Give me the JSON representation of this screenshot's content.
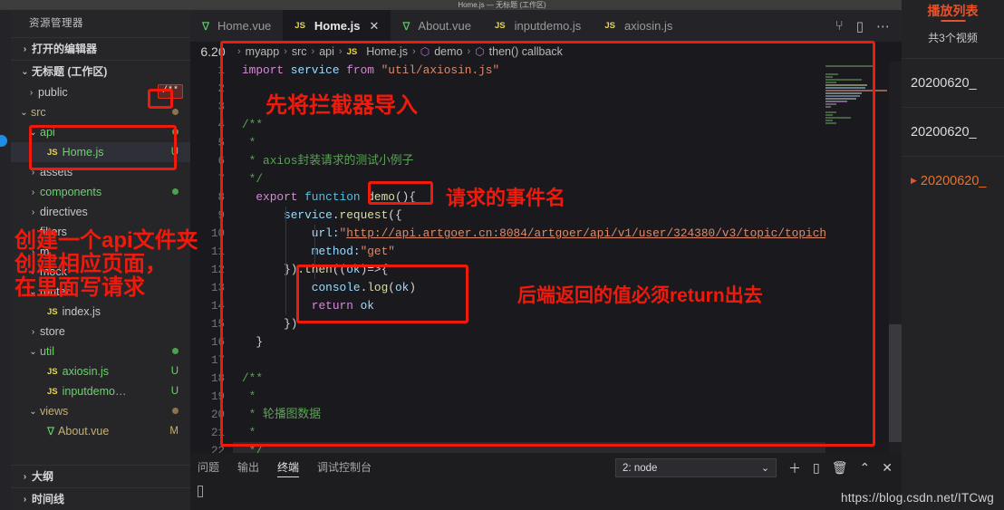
{
  "window": {
    "title": "Home.js — 无标题 (工作区)"
  },
  "sidebar": {
    "header": "资源管理器",
    "sections": [
      {
        "label": "打开的编辑器",
        "twisty": "›"
      },
      {
        "label": "无标题 (工作区)",
        "twisty": "⌄"
      }
    ],
    "tree": [
      {
        "twisty": "›",
        "label": "public",
        "indent": 30,
        "kind": "folder",
        "color": "#c8c8c8",
        "badge": "/**",
        "badge_kind": "comment-badge"
      },
      {
        "twisty": "⌄",
        "label": "src",
        "indent": 22,
        "kind": "folder",
        "color": "#c8b06a",
        "badge": "dot",
        "badge_color": "#8a7450"
      },
      {
        "twisty": "⌄",
        "label": "api",
        "indent": 32,
        "kind": "folder",
        "color": "#6ad46a",
        "badge": "dot",
        "badge_color": "#4f9f53"
      },
      {
        "twisty": "",
        "label": "Home.js",
        "indent": 40,
        "kind": "js",
        "color": "#6ad46a",
        "badge": "U",
        "badge_color": "#6ad46a",
        "selected": true
      },
      {
        "twisty": "›",
        "label": "assets",
        "indent": 32,
        "kind": "folder",
        "color": "#c8c8c8",
        "badge": ""
      },
      {
        "twisty": "›",
        "label": "components",
        "indent": 32,
        "kind": "folder",
        "color": "#6ad46a",
        "badge": "dot",
        "badge_color": "#4f9f53"
      },
      {
        "twisty": "›",
        "label": "directives",
        "indent": 32,
        "kind": "folder",
        "color": "#c8c8c8",
        "badge": ""
      },
      {
        "twisty": "›",
        "label": "filters",
        "indent": 32,
        "kind": "folder",
        "color": "#c8c8c8",
        "badge": ""
      },
      {
        "twisty": "›",
        "label": "m",
        "indent": 32,
        "kind": "folder",
        "color": "#c8c8c8",
        "badge": ""
      },
      {
        "twisty": "›",
        "label": "mock",
        "indent": 32,
        "kind": "folder",
        "color": "#c8c8c8",
        "badge": ""
      },
      {
        "twisty": "⌄",
        "label": "router",
        "indent": 32,
        "kind": "folder",
        "color": "#c8c8c8",
        "badge": ""
      },
      {
        "twisty": "",
        "label": "index.js",
        "indent": 40,
        "kind": "js",
        "color": "#c8c8c8",
        "badge": ""
      },
      {
        "twisty": "›",
        "label": "store",
        "indent": 32,
        "kind": "folder",
        "color": "#c8c8c8",
        "badge": ""
      },
      {
        "twisty": "⌄",
        "label": "util",
        "indent": 32,
        "kind": "folder",
        "color": "#6ad46a",
        "badge": "dot",
        "badge_color": "#4f9f53"
      },
      {
        "twisty": "",
        "label": "axiosin.js",
        "indent": 40,
        "kind": "js",
        "color": "#6ad46a",
        "badge": "U",
        "badge_color": "#6ad46a"
      },
      {
        "twisty": "",
        "label": "inputdemo…",
        "indent": 40,
        "kind": "js",
        "color": "#6ad46a",
        "badge": "U",
        "badge_color": "#6ad46a"
      },
      {
        "twisty": "⌄",
        "label": "views",
        "indent": 32,
        "kind": "folder",
        "color": "#c8b06a",
        "badge": "dot",
        "badge_color": "#8a7450"
      },
      {
        "twisty": "",
        "label": "About.vue",
        "indent": 40,
        "kind": "vue",
        "color": "#c8b06a",
        "badge": "M",
        "badge_color": "#c8b06a"
      }
    ],
    "bottom_sections": [
      {
        "label": "大纲",
        "twisty": "›"
      },
      {
        "label": "时间线",
        "twisty": "›"
      }
    ]
  },
  "tabs": [
    {
      "label": "Home.vue",
      "kind": "vue",
      "active": false,
      "close": ""
    },
    {
      "label": "Home.js",
      "kind": "js",
      "active": true,
      "close": "✕"
    },
    {
      "label": "About.vue",
      "kind": "vue",
      "active": false,
      "close": ""
    },
    {
      "label": "inputdemo.js",
      "kind": "js",
      "active": false,
      "close": ""
    },
    {
      "label": "axiosin.js",
      "kind": "js",
      "active": false,
      "close": ""
    }
  ],
  "tab_actions": [
    {
      "name": "split-run-icon",
      "glyph": "⑂"
    },
    {
      "name": "split-editor-icon",
      "glyph": "▯"
    },
    {
      "name": "more-actions-icon",
      "glyph": "⋯"
    }
  ],
  "editor": {
    "line_badge": "6.20",
    "breadcrumb": [
      {
        "text": "myapp",
        "icon": ""
      },
      {
        "text": "src",
        "icon": ""
      },
      {
        "text": "api",
        "icon": ""
      },
      {
        "text": "Home.js",
        "icon": "js"
      },
      {
        "text": "demo",
        "icon": "cube"
      },
      {
        "text": "then() callback",
        "icon": "cube"
      }
    ],
    "line_numbers": [
      "1",
      "2",
      "3",
      "4",
      "5",
      "6",
      "7",
      "8",
      "9",
      "10",
      "11",
      "12",
      "13",
      "14",
      "15",
      "16",
      "17",
      "18",
      "19",
      "20",
      "21",
      "22"
    ],
    "code_lines": [
      {
        "n": 1,
        "tokens": [
          {
            "t": "import ",
            "c": "k-key"
          },
          {
            "t": "service",
            "c": "k-var"
          },
          {
            "t": " from ",
            "c": "k-key"
          },
          {
            "t": "\"util/axiosin.js\"",
            "c": "k-str"
          }
        ]
      },
      {
        "n": 2,
        "tokens": []
      },
      {
        "n": 3,
        "tokens": []
      },
      {
        "n": 4,
        "tokens": [
          {
            "t": "/**",
            "c": "k-cm"
          }
        ]
      },
      {
        "n": 5,
        "tokens": [
          {
            "t": " *",
            "c": "k-cm"
          }
        ]
      },
      {
        "n": 6,
        "tokens": [
          {
            "t": " * axios封装请求的测试小例子",
            "c": "k-cm"
          }
        ]
      },
      {
        "n": 7,
        "tokens": [
          {
            "t": " */",
            "c": "k-cm"
          }
        ]
      },
      {
        "n": 8,
        "tokens": [
          {
            "t": "  export ",
            "c": "k-key"
          },
          {
            "t": "function ",
            "c": "k-kw2"
          },
          {
            "t": "demo",
            "c": "k-fn"
          },
          {
            "t": "(){",
            "c": "k-id"
          }
        ]
      },
      {
        "n": 9,
        "tokens": [
          {
            "t": "      service",
            "c": "k-var"
          },
          {
            "t": ".",
            "c": "k-id"
          },
          {
            "t": "request",
            "c": "k-fn"
          },
          {
            "t": "({",
            "c": "k-id"
          }
        ]
      },
      {
        "n": 10,
        "tokens": [
          {
            "t": "          url:",
            "c": "k-var"
          },
          {
            "t": "\"",
            "c": "k-str"
          },
          {
            "t": "http://api.artgoer.cn:8084/artgoer/api/v1/user/324380/v3/topic/topich",
            "c": "k-url"
          }
        ]
      },
      {
        "n": 11,
        "tokens": [
          {
            "t": "          method:",
            "c": "k-var"
          },
          {
            "t": "\"get\"",
            "c": "k-str"
          }
        ]
      },
      {
        "n": 12,
        "tokens": [
          {
            "t": "      }).",
            "c": "k-id"
          },
          {
            "t": "then",
            "c": "k-fn"
          },
          {
            "t": "((",
            "c": "k-id"
          },
          {
            "t": "ok",
            "c": "k-var"
          },
          {
            "t": ")=>{",
            "c": "k-id"
          }
        ]
      },
      {
        "n": 13,
        "tokens": [
          {
            "t": "          console",
            "c": "k-var"
          },
          {
            "t": ".",
            "c": "k-id"
          },
          {
            "t": "log",
            "c": "k-fn"
          },
          {
            "t": "(",
            "c": "k-id"
          },
          {
            "t": "ok",
            "c": "k-var"
          },
          {
            "t": ")",
            "c": "k-id"
          }
        ]
      },
      {
        "n": 14,
        "tokens": [
          {
            "t": "          return ",
            "c": "k-key"
          },
          {
            "t": "ok",
            "c": "k-var"
          }
        ]
      },
      {
        "n": 15,
        "tokens": [
          {
            "t": "      })",
            "c": "k-id"
          }
        ]
      },
      {
        "n": 16,
        "tokens": [
          {
            "t": "  }",
            "c": "k-id"
          }
        ]
      },
      {
        "n": 17,
        "tokens": []
      },
      {
        "n": 18,
        "tokens": [
          {
            "t": "/**",
            "c": "k-cm"
          }
        ]
      },
      {
        "n": 19,
        "tokens": [
          {
            "t": " *",
            "c": "k-cm"
          }
        ]
      },
      {
        "n": 20,
        "tokens": [
          {
            "t": " * 轮播图数据",
            "c": "k-cm"
          }
        ]
      },
      {
        "n": 21,
        "tokens": [
          {
            "t": " *",
            "c": "k-cm"
          }
        ]
      },
      {
        "n": 22,
        "tokens": [
          {
            "t": " */",
            "c": "k-cm"
          }
        ],
        "highlight": true
      }
    ]
  },
  "panel": {
    "tabs": [
      {
        "label": "问题",
        "active": false
      },
      {
        "label": "输出",
        "active": false
      },
      {
        "label": "终端",
        "active": true
      },
      {
        "label": "调试控制台",
        "active": false
      }
    ],
    "select_value": "2: node",
    "actions": [
      {
        "name": "new-terminal-icon",
        "glyph": "＋"
      },
      {
        "name": "split-terminal-icon",
        "glyph": "▯"
      },
      {
        "name": "kill-terminal-icon",
        "glyph": "🗑"
      },
      {
        "name": "collapse-panel-icon",
        "glyph": "⌃"
      },
      {
        "name": "close-panel-icon",
        "glyph": "✕"
      }
    ]
  },
  "playlist": {
    "title": "播放列表",
    "count": "共3个视频",
    "items": [
      {
        "label": "20200620_",
        "active": false
      },
      {
        "label": "20200620_",
        "active": false
      },
      {
        "label": "20200620_",
        "active": true
      }
    ]
  },
  "annotations": {
    "a1": "先将拦截器导入",
    "a2": "请求的事件名",
    "a3": "后端返回的值必须return出去",
    "a4": "创建一个api文件夹",
    "a5": "创建相应页面，",
    "a6": "在里面写请求"
  },
  "watermark": "https://blog.csdn.net/ITCwg",
  "colors": {
    "accent_red": "#f01a0c",
    "playlist_accent": "#e8522a",
    "editor_bg": "#1a1a1e",
    "sidebar_bg": "#262629"
  }
}
